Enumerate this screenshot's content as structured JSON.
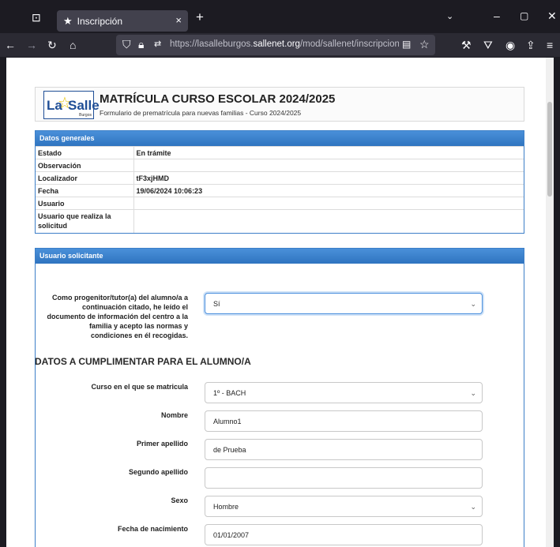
{
  "browser": {
    "tab_title": "Inscripción",
    "tab_close": "×",
    "new_tab": "+",
    "url_prefix": "https://lasalleburgos.",
    "url_host": "sallenet.org",
    "url_path": "/mod/sallenet/inscripciones/sol"
  },
  "header": {
    "logo_la": "La",
    "logo_salle": "Salle",
    "logo_city": "Burgos",
    "title": "MATRÍCULA CURSO ESCOLAR 2024/2025",
    "subtitle": "Formulario de prematrícula para nuevas familias - Curso 2024/2025"
  },
  "datos_generales": {
    "heading": "Datos generales",
    "rows": [
      {
        "key": "Estado",
        "value": "En trámite"
      },
      {
        "key": "Observación",
        "value": ""
      },
      {
        "key": "Localizador",
        "value": "tF3xjHMD"
      },
      {
        "key": "Fecha",
        "value": "19/06/2024 10:06:23"
      },
      {
        "key": "Usuario",
        "value": ""
      },
      {
        "key": "Usuario que realiza la solicitud",
        "value": ""
      }
    ]
  },
  "usuario_solicitante": {
    "heading": "Usuario solicitante",
    "consent_label": "Como progenitor/tutor(a) del alumno/a a continuación citado, he leído el documento de información del centro a la familia y acepto las normas y condiciones en él recogidas.",
    "consent_value": "Sí"
  },
  "alumno": {
    "section_title": "DATOS A CUMPLIMENTAR PARA EL ALUMNO/A",
    "curso_label": "Curso en el que se matricula",
    "curso_value": "1º - BACH",
    "nombre_label": "Nombre",
    "nombre_value": "Alumno1",
    "apellido1_label": "Primer apellido",
    "apellido1_value": "de Prueba",
    "apellido2_label": "Segundo apellido",
    "apellido2_value": "",
    "sexo_label": "Sexo",
    "sexo_value": "Hombre",
    "fecha_label": "Fecha de nacimiento",
    "fecha_value": "01/01/2007"
  }
}
